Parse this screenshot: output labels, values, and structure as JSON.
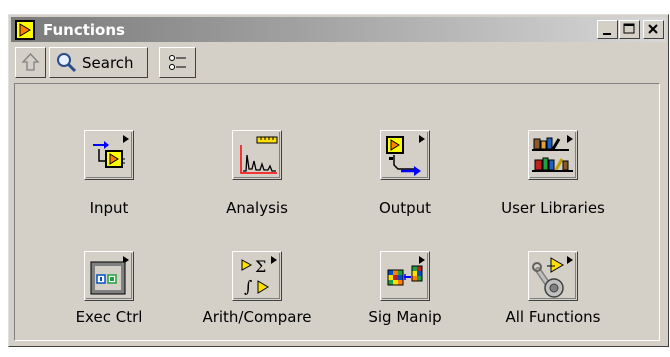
{
  "window": {
    "title": "Functions",
    "title_icon": "labview-vi-icon",
    "controls": [
      "minimize-icon",
      "maximize-icon",
      "close-icon"
    ]
  },
  "toolbar": {
    "up_icon": "up-arrow-icon",
    "search_label": "Search",
    "search_icon": "magnifier-icon",
    "view_options_icon": "view-options-icon"
  },
  "palette": {
    "items": [
      {
        "label": "Input",
        "icon": "input-icon"
      },
      {
        "label": "Analysis",
        "icon": "analysis-icon"
      },
      {
        "label": "Output",
        "icon": "output-icon"
      },
      {
        "label": "User Libraries",
        "icon": "user-libraries-icon"
      },
      {
        "label": "Exec Ctrl",
        "icon": "exec-ctrl-icon"
      },
      {
        "label": "Arith/Compare",
        "icon": "arith-compare-icon"
      },
      {
        "label": "Sig Manip",
        "icon": "sig-manip-icon"
      },
      {
        "label": "All Functions",
        "icon": "all-functions-icon"
      }
    ]
  },
  "colors": {
    "face": "#d4d0c8",
    "title_start": "#7a7a7a",
    "title_end": "#d8d8d8",
    "vi_yellow": "#ffff00",
    "arrow_blue": "#0000ff"
  }
}
